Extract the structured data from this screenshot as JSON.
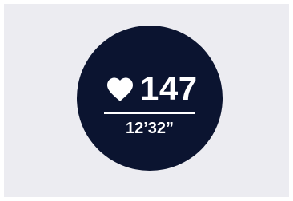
{
  "workout": {
    "heart_rate": "147",
    "elapsed_time": "12’32”"
  },
  "icons": {
    "heart": "heart-icon"
  },
  "colors": {
    "background": "#ececf1",
    "face": "#0b1430",
    "foreground": "#ffffff"
  }
}
